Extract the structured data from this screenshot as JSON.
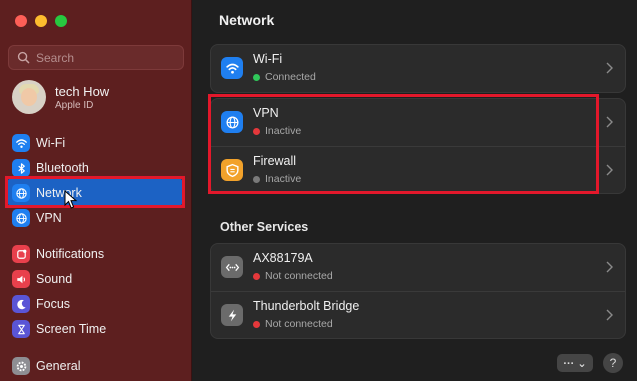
{
  "sidebar": {
    "search_placeholder": "Search",
    "account": {
      "name": "tech How",
      "subtitle": "Apple ID"
    },
    "items": [
      {
        "label": "Wi-Fi",
        "icon": "wifi-icon",
        "color": "#1f7ff0"
      },
      {
        "label": "Bluetooth",
        "icon": "bluetooth-icon",
        "color": "#1f7ff0"
      },
      {
        "label": "Network",
        "icon": "globe-icon",
        "color": "#1f7ff0",
        "selected": true
      },
      {
        "label": "VPN",
        "icon": "globe-icon",
        "color": "#1f7ff0"
      },
      {
        "label": "Notifications",
        "icon": "bell-icon",
        "color": "#e8404c"
      },
      {
        "label": "Sound",
        "icon": "speaker-icon",
        "color": "#e8404c"
      },
      {
        "label": "Focus",
        "icon": "moon-icon",
        "color": "#5a55d6"
      },
      {
        "label": "Screen Time",
        "icon": "hourglass-icon",
        "color": "#5a55d6"
      },
      {
        "label": "General",
        "icon": "gear-icon",
        "color": "#8e8e93"
      }
    ]
  },
  "main": {
    "title": "Network",
    "primary": [
      {
        "title": "Wi-Fi",
        "status": "Connected",
        "status_color": "#30c75a",
        "icon": "wifi-icon",
        "icon_bg": "#1f7ff0"
      }
    ],
    "highlighted": [
      {
        "title": "VPN",
        "status": "Inactive",
        "status_color": "#e5383b",
        "icon": "globe-icon",
        "icon_bg": "#1f7ff0"
      },
      {
        "title": "Firewall",
        "status": "Inactive",
        "status_color": "#7a7a7a",
        "icon": "firewall-icon",
        "icon_bg": "#f2a22b"
      }
    ],
    "other_services_title": "Other Services",
    "other_services": [
      {
        "title": "AX88179A",
        "status": "Not connected",
        "status_color": "#e5383b",
        "icon": "ethernet-icon",
        "icon_bg": "#6b6b6b"
      },
      {
        "title": "Thunderbolt Bridge",
        "status": "Not connected",
        "status_color": "#e5383b",
        "icon": "thunderbolt-icon",
        "icon_bg": "#6b6b6b"
      }
    ],
    "more_button": "··· ⌄",
    "help_button": "?"
  },
  "colors": {
    "highlight": "#e3182b",
    "selection": "#1c62c4",
    "sidebar_bg": "#5d1f1f"
  }
}
